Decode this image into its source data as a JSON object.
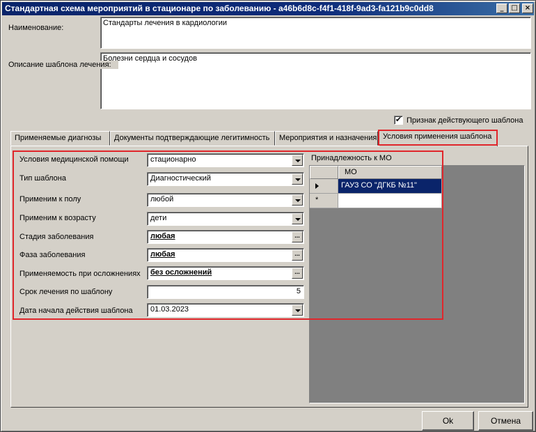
{
  "window": {
    "title": "Стандартная схема мероприятий в стационаре по заболеванию - a46b6d8c-f4f1-418f-9ad3-fa121b9c0dd8",
    "minimize_glyph": "_",
    "maximize_glyph": "□",
    "close_glyph": "×"
  },
  "form": {
    "name_label": "Наименование:",
    "name_value": "Стандарты лечения в кардиологии",
    "desc_label": "Описание шаблона лечения:",
    "desc_value": "Болезни сердца и сосудов",
    "active_label": "Признак действующего шаблона",
    "active_checked": true,
    "check_glyph": "✔"
  },
  "tabs": [
    {
      "label": "Применяемые диагнозы",
      "active": false
    },
    {
      "label": "Документы подтверждающие легитимность",
      "active": false
    },
    {
      "label": "Мероприятия и назначения",
      "active": false
    },
    {
      "label": "Условия применения шаблона",
      "active": true
    }
  ],
  "conditions": {
    "fields": [
      {
        "label": "Условия медицинской помощи",
        "value": "стационарно",
        "control": "dropdown"
      },
      {
        "label": "Тип шаблона",
        "value": "Диагностический",
        "control": "dropdown"
      },
      {
        "label": "Применим к полу",
        "value": "любой",
        "control": "dropdown"
      },
      {
        "label": "Применим к возрасту",
        "value": "дети",
        "control": "dropdown"
      },
      {
        "label": "Стадия заболевания",
        "value": "любая",
        "control": "ellipsis"
      },
      {
        "label": "Фаза заболевания",
        "value": "любая",
        "control": "ellipsis"
      },
      {
        "label": "Применяемость при осложнениях",
        "value": "без осложнений",
        "control": "ellipsis"
      },
      {
        "label": "Срок лечения по шаблону",
        "value": "5",
        "control": "number"
      },
      {
        "label": "Дата начала действия шаблона",
        "value": "01.03.2023",
        "control": "dropdown"
      }
    ],
    "ellipsis_glyph": "..."
  },
  "mo_grid": {
    "label": "Принадлежность к МО",
    "column": "МО",
    "rows": [
      "ГАУЗ СО \"ДГКБ №11\""
    ],
    "new_row_glyph": "*",
    "selected_color": "#0a246a"
  },
  "buttons": {
    "ok": "Ok",
    "cancel": "Отмена"
  },
  "highlight_color": "#e0262b"
}
